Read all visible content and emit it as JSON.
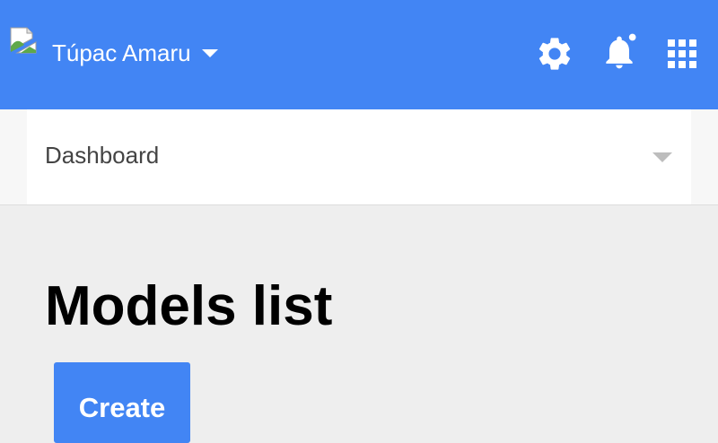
{
  "header": {
    "background_color": "#4285f4",
    "logo_icon": "broken-image-icon",
    "user_name": "Túpac Amaru",
    "user_menu_icon": "caret-down-icon",
    "settings_icon": "gear-icon",
    "notifications_icon": "bell-icon",
    "notifications_has_unread": true,
    "apps_icon": "apps-grid-icon"
  },
  "dashboard_selector": {
    "selected": "Dashboard",
    "icon": "caret-down-icon"
  },
  "main": {
    "title": "Models list",
    "create_label": "Create",
    "accent_color": "#4285f4"
  }
}
